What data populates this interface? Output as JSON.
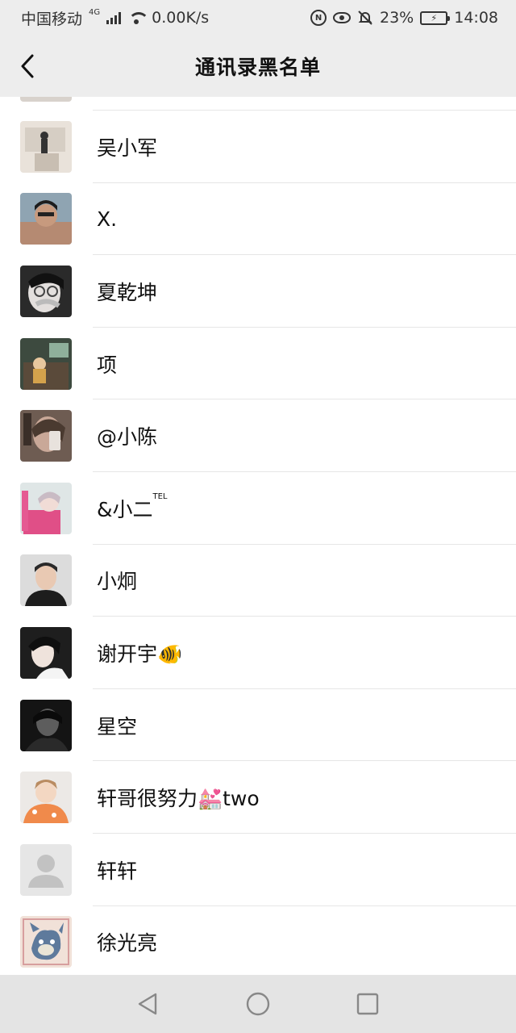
{
  "status_bar": {
    "carrier": "中国移动",
    "network": "4G",
    "speed": "0.00K/s",
    "icons": [
      "signal-icon",
      "wifi-icon",
      "nfc-icon",
      "eye-icon",
      "mute-bell-icon",
      "battery-icon"
    ],
    "battery": "23%",
    "time": "14:08"
  },
  "header": {
    "title": "通讯录黑名单",
    "back_icon": "chevron-left-icon"
  },
  "contacts": [
    {
      "name": "吴小军",
      "avatar": "photo"
    },
    {
      "name": "X.",
      "avatar": "photo"
    },
    {
      "name": "夏乾坤",
      "avatar": "photo"
    },
    {
      "name": "项",
      "avatar": "photo"
    },
    {
      "name": "@小陈",
      "avatar": "photo"
    },
    {
      "name": "&小二",
      "sup": "TEL",
      "avatar": "photo"
    },
    {
      "name": "小炯",
      "avatar": "photo"
    },
    {
      "name": "谢开宇🐠",
      "avatar": "photo"
    },
    {
      "name": "星空",
      "avatar": "photo"
    },
    {
      "name": "轩哥很努力💒two",
      "avatar": "photo"
    },
    {
      "name": "轩轩",
      "avatar": "default"
    },
    {
      "name": "徐光亮",
      "avatar": "cartoon"
    }
  ],
  "system_nav": {
    "back": "triangle-back-icon",
    "home": "circle-home-icon",
    "recents": "square-recents-icon"
  },
  "colors": {
    "background": "#ededed",
    "list_bg": "#ffffff",
    "divider": "#e6e6e6",
    "nav_bar": "#e4e4e4"
  }
}
